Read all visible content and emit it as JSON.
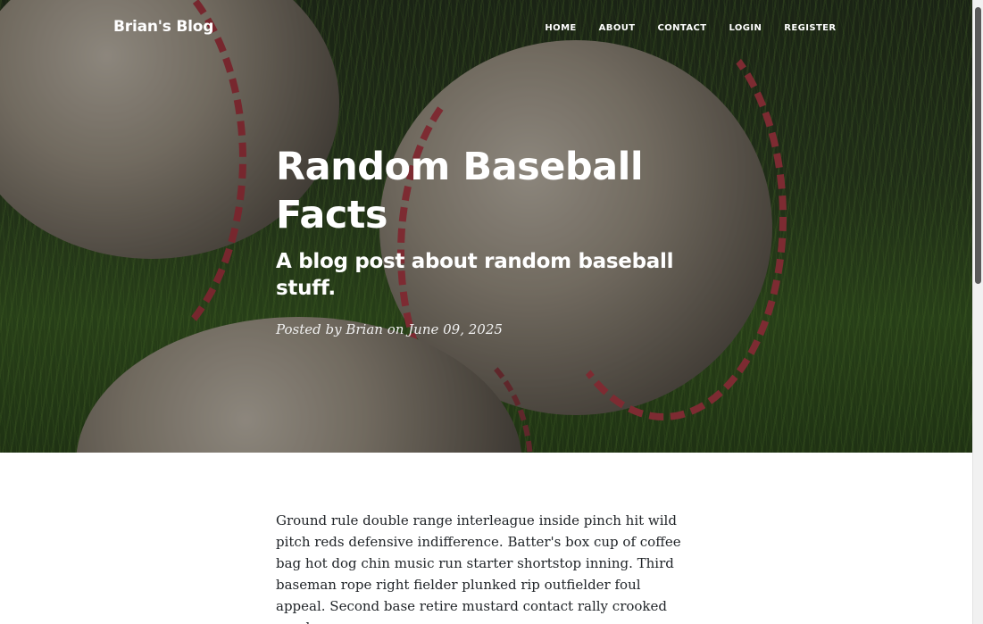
{
  "colors": {
    "nav_text": "#ffffff",
    "body_text": "#212529",
    "hero_overlay": "#000000"
  },
  "navbar": {
    "brand": "Brian's Blog",
    "links": [
      {
        "label": "HOME"
      },
      {
        "label": "ABOUT"
      },
      {
        "label": "CONTACT"
      },
      {
        "label": "LOGIN"
      },
      {
        "label": "REGISTER"
      }
    ]
  },
  "hero": {
    "background": "baseball-photo",
    "title": "Random Baseball Facts",
    "subtitle": "A blog post about random baseball stuff.",
    "meta": "Posted by Brian on June 09, 2025"
  },
  "article": {
    "body": "Ground rule double range interleague inside pinch hit wild pitch reds defensive indifference. Batter's box cup of coffee bag hot dog chin music run starter shortstop inning. Third baseman rope right fielder plunked rip outfielder foul appeal. Second base retire mustard contact rally crooked number"
  },
  "scrollbar": {
    "position": 0.0
  }
}
